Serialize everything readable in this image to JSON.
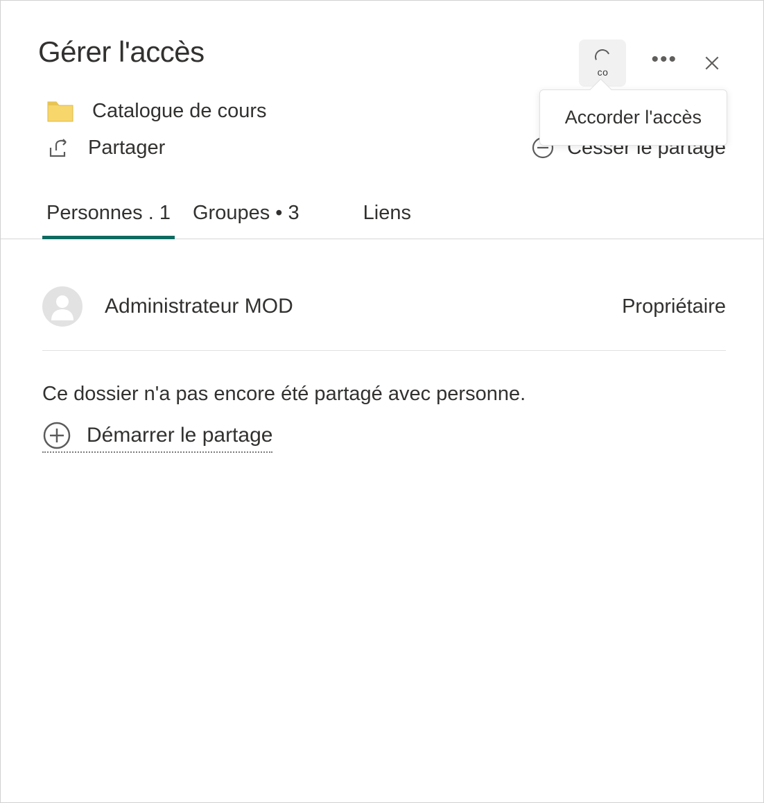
{
  "header": {
    "title": "Gérer l'accès",
    "grant_code": "co",
    "tooltip": "Accorder l'accès"
  },
  "folder": {
    "name": "Catalogue de cours"
  },
  "share": {
    "label": "Partager",
    "stop_label": "Cesser le partage"
  },
  "tabs": {
    "people": {
      "label": "Personnes",
      "count": "1"
    },
    "groups": {
      "label": "Groupes",
      "count": "3"
    },
    "links": {
      "label": "Liens"
    }
  },
  "people": [
    {
      "name": "Administrateur MOD",
      "role": "Propriétaire"
    }
  ],
  "empty": {
    "message": "Ce dossier n'a pas encore été partagé avec personne.",
    "start_label": "Démarrer le partage"
  }
}
